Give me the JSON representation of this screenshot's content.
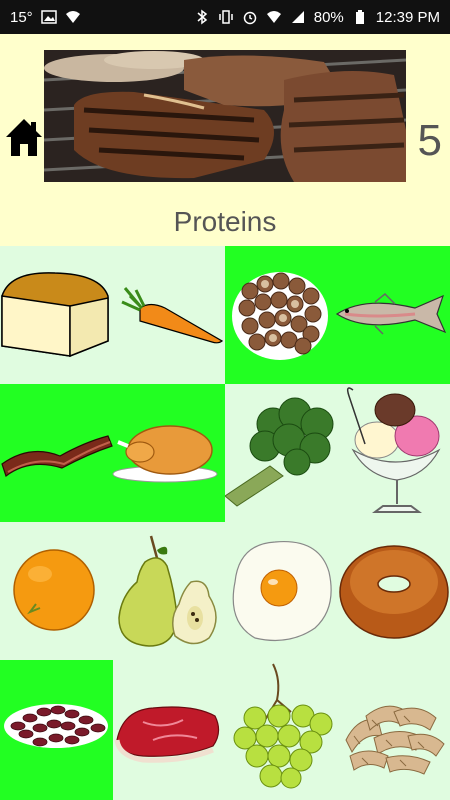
{
  "status_bar": {
    "temperature": "15°",
    "battery": "80%",
    "time": "12:39 PM",
    "icons": [
      "image-icon",
      "wifi-icon",
      "bluetooth-icon",
      "vibrate-icon",
      "alarm-icon",
      "wifi-icon",
      "signal-icon",
      "battery-icon"
    ]
  },
  "header": {
    "home_icon": "home-icon",
    "level_number": "5",
    "title": "Proteins"
  },
  "colors": {
    "header_background": "#FFFFCC",
    "tile_light": "#E0FCE0",
    "tile_selected": "#22FF22",
    "text": "#555555"
  },
  "tiles": [
    {
      "items": [
        "bread",
        "carrot"
      ],
      "selected": false
    },
    {
      "items": [
        "nuts",
        "fish"
      ],
      "selected": true
    },
    {
      "items": [
        "bacon",
        "roast-chicken"
      ],
      "selected": true
    },
    {
      "items": [
        "broccoli",
        "ice-cream-sundae"
      ],
      "selected": false
    },
    {
      "items": [
        "orange"
      ],
      "selected": false
    },
    {
      "items": [
        "pears"
      ],
      "selected": false
    },
    {
      "items": [
        "fried-egg"
      ],
      "selected": false
    },
    {
      "items": [
        "bagel"
      ],
      "selected": false
    },
    {
      "items": [
        "kidney-beans"
      ],
      "selected": true
    },
    {
      "items": [
        "steak"
      ],
      "selected": false
    },
    {
      "items": [
        "grapes"
      ],
      "selected": false
    },
    {
      "items": [
        "pasta"
      ],
      "selected": false
    }
  ]
}
